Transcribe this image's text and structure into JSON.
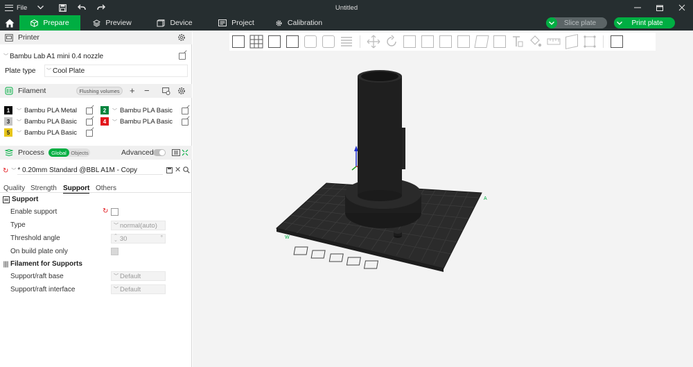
{
  "window": {
    "title": "Untitled",
    "menu_label": "File"
  },
  "tabs": [
    {
      "label": "Prepare",
      "active": true,
      "icon": "cube-icon"
    },
    {
      "label": "Preview",
      "active": false,
      "icon": "layers-icon"
    },
    {
      "label": "Device",
      "active": false,
      "icon": "printer-icon"
    },
    {
      "label": "Project",
      "active": false,
      "icon": "document-icon"
    },
    {
      "label": "Calibration",
      "active": false,
      "icon": "gear-icon"
    }
  ],
  "actions": {
    "slice_label": "Slice plate",
    "print_label": "Print plate"
  },
  "printer": {
    "section_title": "Printer",
    "name": "Bambu Lab A1 mini 0.4 nozzle",
    "plate_type_label": "Plate type",
    "plate_type_value": "Cool Plate"
  },
  "filament": {
    "section_title": "Filament",
    "flushing_label": "Flushing volumes",
    "items": [
      {
        "num": "1",
        "name": "Bambu PLA Metal",
        "color": "#0a0a0a",
        "text_color": "#ffffff"
      },
      {
        "num": "2",
        "name": "Bambu PLA Basic",
        "color": "#00843d",
        "text_color": "#ffffff"
      },
      {
        "num": "3",
        "name": "Bambu PLA Basic",
        "color": "#c4c4c4",
        "text_color": "#222222"
      },
      {
        "num": "4",
        "name": "Bambu PLA Basic",
        "color": "#e2161b",
        "text_color": "#ffffff"
      },
      {
        "num": "5",
        "name": "Bambu PLA Basic",
        "color": "#e8c619",
        "text_color": "#222222"
      }
    ]
  },
  "process": {
    "section_title": "Process",
    "global_label": "Global",
    "objects_label": "Objects",
    "advanced_label": "Advanced",
    "profile_name": "* 0.20mm Standard @BBL A1M - Copy",
    "subtabs": [
      "Quality",
      "Strength",
      "Support",
      "Others"
    ],
    "active_subtab": "Support"
  },
  "support": {
    "group_title": "Support",
    "enable_label": "Enable support",
    "type_label": "Type",
    "type_value": "normal(auto)",
    "threshold_label": "Threshold angle",
    "threshold_value": "30",
    "threshold_unit": "°",
    "build_plate_only_label": "On build plate only",
    "filament_group_title": "Filament for Supports",
    "base_label": "Support/raft base",
    "base_value": "Default",
    "interface_label": "Support/raft interface",
    "interface_value": "Default"
  },
  "colors": {
    "accent": "#00ae42",
    "titlebar": "#262e30",
    "plate": "#2b2b2b",
    "model": "#1e1e1e"
  }
}
